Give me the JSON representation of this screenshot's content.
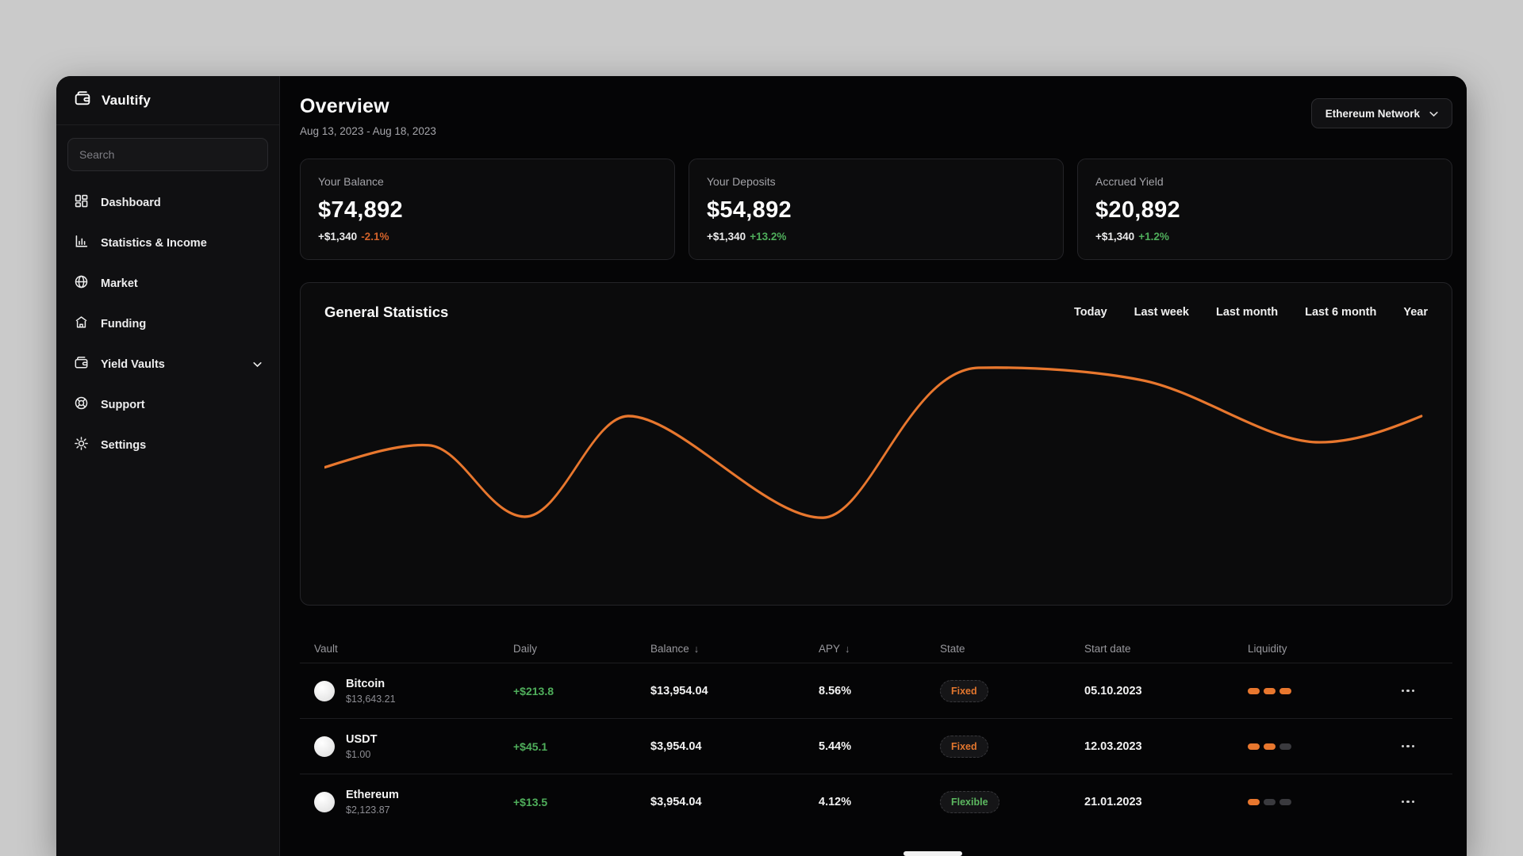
{
  "app": {
    "name": "Vaultify"
  },
  "colors": {
    "accent_orange": "#E8772E",
    "positive_green": "#4FAE5B",
    "negative_orange": "#D2622A",
    "panel_background": "#0B0B0C",
    "page_background": "#CACACA"
  },
  "sidebar": {
    "search_placeholder": "Search",
    "items": [
      {
        "label": "Dashboard",
        "icon": "dashboard-icon"
      },
      {
        "label": "Statistics & Income",
        "icon": "bar-chart-icon"
      },
      {
        "label": "Market",
        "icon": "globe-icon"
      },
      {
        "label": "Funding",
        "icon": "bank-icon"
      },
      {
        "label": "Yield Vaults",
        "icon": "wallet-icon",
        "has_chevron": true
      },
      {
        "label": "Support",
        "icon": "lifebuoy-icon"
      },
      {
        "label": "Settings",
        "icon": "gear-icon"
      }
    ]
  },
  "header": {
    "title": "Overview",
    "date_range": "Aug 13, 2023 - Aug 18, 2023",
    "network_selector": "Ethereum Network"
  },
  "stat_cards": [
    {
      "label": "Your Balance",
      "value": "$74,892",
      "delta": "+$1,340",
      "delta_pct": "-2.1%",
      "trend": "down"
    },
    {
      "label": "Your Deposits",
      "value": "$54,892",
      "delta": "+$1,340",
      "delta_pct": "+13.2%",
      "trend": "up"
    },
    {
      "label": "Accrued Yield",
      "value": "$20,892",
      "delta": "+$1,340",
      "delta_pct": "+1.2%",
      "trend": "up"
    }
  ],
  "chart": {
    "title": "General Statistics",
    "ranges": [
      "Today",
      "Last week",
      "Last month",
      "Last 6 month",
      "Year"
    ],
    "line_color": "#E8772E",
    "axes_visible": false,
    "normalized_curve_points": [
      [
        0.0,
        0.54
      ],
      [
        0.09,
        0.45
      ],
      [
        0.18,
        0.76
      ],
      [
        0.27,
        0.32
      ],
      [
        0.45,
        0.76
      ],
      [
        0.59,
        0.11
      ],
      [
        0.74,
        0.16
      ],
      [
        0.9,
        0.43
      ],
      [
        1.0,
        0.32
      ]
    ]
  },
  "table": {
    "columns": {
      "vault": "Vault",
      "daily": "Daily",
      "balance": "Balance",
      "apy": "APY",
      "state": "State",
      "start_date": "Start date",
      "liquidity": "Liquidity"
    },
    "sort_arrow": "↓",
    "rows": [
      {
        "name": "Bitcoin",
        "price": "$13,643.21",
        "daily": "+$213.8",
        "balance": "$13,954.04",
        "apy": "8.56%",
        "state": "Fixed",
        "start_date": "05.10.2023",
        "liquidity": 3
      },
      {
        "name": "USDT",
        "price": "$1.00",
        "daily": "+$45.1",
        "balance": "$3,954.04",
        "apy": "5.44%",
        "state": "Fixed",
        "start_date": "12.03.2023",
        "liquidity": 2
      },
      {
        "name": "Ethereum",
        "price": "$2,123.87",
        "daily": "+$13.5",
        "balance": "$3,954.04",
        "apy": "4.12%",
        "state": "Flexible",
        "start_date": "21.01.2023",
        "liquidity": 1
      }
    ]
  }
}
